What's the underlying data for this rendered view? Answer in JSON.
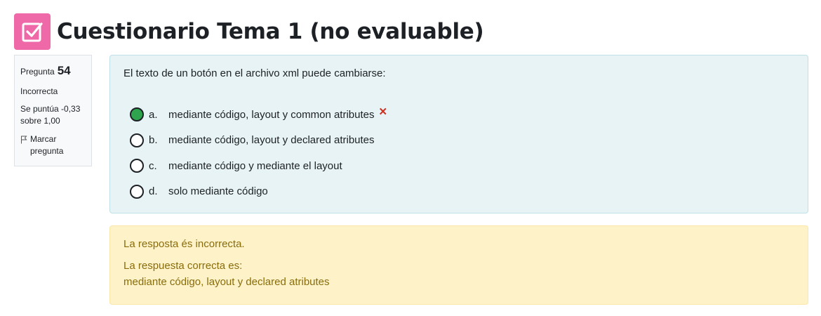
{
  "page": {
    "title": "Cuestionario Tema 1 (no evaluable)",
    "icon": "quiz-checkbox-icon",
    "icon_color": "#ef68a8"
  },
  "question_info": {
    "label": "Pregunta",
    "number": "54",
    "state": "Incorrecta",
    "grade": "Se puntúa -0,33 sobre 1,00",
    "flag_label": "Marcar pregunta"
  },
  "question": {
    "text": "El texto de un botón en el archivo xml puede cambiarse:",
    "answers": [
      {
        "letter": "a.",
        "text": "mediante código, layout y common atributes",
        "selected": true,
        "incorrect_mark": "✕"
      },
      {
        "letter": "b.",
        "text": "mediante código, layout y declared atributes",
        "selected": false
      },
      {
        "letter": "c.",
        "text": "mediante código y mediante el layout",
        "selected": false
      },
      {
        "letter": "d.",
        "text": "solo mediante código",
        "selected": false
      }
    ]
  },
  "feedback": {
    "result": "La resposta és incorrecta.",
    "correct_label": "La respuesta correcta es:",
    "correct_answer": "mediante código, layout y declared atributes"
  },
  "colors": {
    "question_bg": "#e7f3f5",
    "feedback_bg": "#fdf2c8",
    "feedback_text": "#8a6d0b",
    "selected_radio": "#2ea44f",
    "incorrect": "#ca3120"
  }
}
